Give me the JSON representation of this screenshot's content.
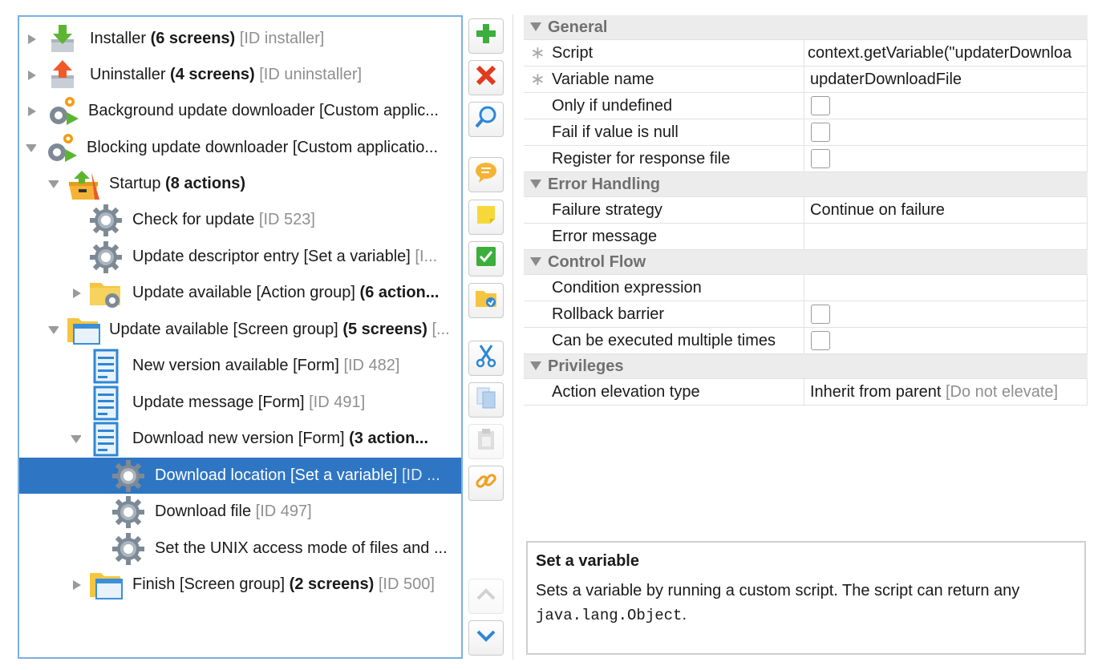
{
  "tree": {
    "nodes": [
      {
        "label": "Installer",
        "bold": "(6 screens)",
        "muted": "[ID installer]",
        "icon": "download-arrow-icon"
      },
      {
        "label": "Uninstaller",
        "bold": "(4 screens)",
        "muted": "[ID uninstaller]",
        "icon": "upload-arrow-icon"
      },
      {
        "label": "Background update downloader [Custom applic...",
        "bold": "",
        "muted": "",
        "icon": "custom-application-icon"
      },
      {
        "label": "Blocking update downloader [Custom applicatio...",
        "bold": "",
        "muted": "",
        "icon": "custom-application-icon"
      },
      {
        "label": "Startup",
        "bold": "(8 actions)",
        "muted": "",
        "icon": "startup-box-icon"
      },
      {
        "label": "Check for update",
        "bold": "",
        "muted": "[ID 523]",
        "icon": "gear-icon"
      },
      {
        "label": "Update descriptor entry [Set a variable]",
        "bold": "",
        "muted": "[I...",
        "icon": "gear-icon"
      },
      {
        "label": "Update available [Action group]",
        "bold": "(6 action...",
        "muted": "",
        "icon": "folder-gear-icon"
      },
      {
        "label": "Update available [Screen group]",
        "bold": "(5 screens)",
        "muted": "[...",
        "icon": "folder-screen-icon"
      },
      {
        "label": "New version available [Form]",
        "bold": "",
        "muted": "[ID 482]",
        "icon": "form-icon"
      },
      {
        "label": "Update message [Form]",
        "bold": "",
        "muted": "[ID 491]",
        "icon": "form-icon"
      },
      {
        "label": "Download new version [Form]",
        "bold": "(3 action...",
        "muted": "",
        "icon": "form-icon"
      },
      {
        "label": "Download location [Set a variable]",
        "bold": "",
        "muted": "[ID ...",
        "icon": "gear-icon"
      },
      {
        "label": "Download file",
        "bold": "",
        "muted": "[ID 497]",
        "icon": "gear-icon"
      },
      {
        "label": "Set the UNIX access mode of files and ...",
        "bold": "",
        "muted": "",
        "icon": "gear-icon"
      },
      {
        "label": "Finish [Screen group]",
        "bold": "(2 screens)",
        "muted": "[ID 500]",
        "icon": "folder-screen-icon"
      }
    ]
  },
  "toolbar": {
    "buttons": [
      "add-icon",
      "delete-icon",
      "search-icon",
      "comment-icon",
      "note-icon",
      "check-icon",
      "folder-icon",
      "cut-icon",
      "copy-icon",
      "paste-icon",
      "link-icon",
      "move-up-icon",
      "move-down-icon"
    ]
  },
  "properties": {
    "general": {
      "title": "General",
      "script_label": "Script",
      "script_value": "context.getVariable(\"updaterDownloa",
      "varname_label": "Variable name",
      "varname_value": "updaterDownloadFile",
      "only_undefined_label": "Only if undefined",
      "fail_null_label": "Fail if value is null",
      "register_label": "Register for response file"
    },
    "error_handling": {
      "title": "Error Handling",
      "strategy_label": "Failure strategy",
      "strategy_value": "Continue on failure",
      "message_label": "Error message"
    },
    "control_flow": {
      "title": "Control Flow",
      "condition_label": "Condition expression",
      "rollback_label": "Rollback barrier",
      "multiple_label": "Can be executed multiple times"
    },
    "privileges": {
      "title": "Privileges",
      "elevation_label": "Action elevation type",
      "elevation_value": "Inherit from parent",
      "elevation_muted": "[Do not elevate]"
    },
    "required_marker": "∗"
  },
  "description": {
    "title": "Set a variable",
    "text": "Sets a variable by running a custom script. The script can return any",
    "code": "java.lang.Object",
    "tail": "."
  }
}
